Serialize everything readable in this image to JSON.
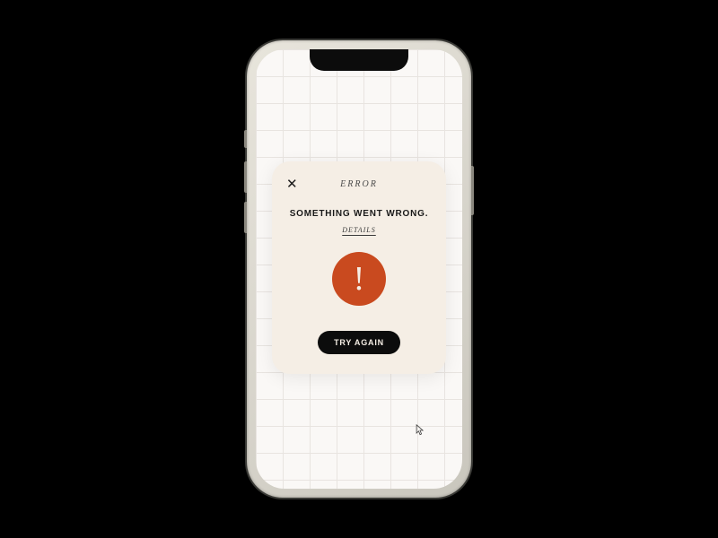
{
  "modal": {
    "title": "ERROR",
    "message": "SOMETHING WENT WRONG.",
    "details_label": "DETAILS",
    "button_label": "TRY AGAIN"
  },
  "colors": {
    "accent": "#c94a1f",
    "bg": "#f5eee5",
    "text": "#1a1a1a"
  }
}
